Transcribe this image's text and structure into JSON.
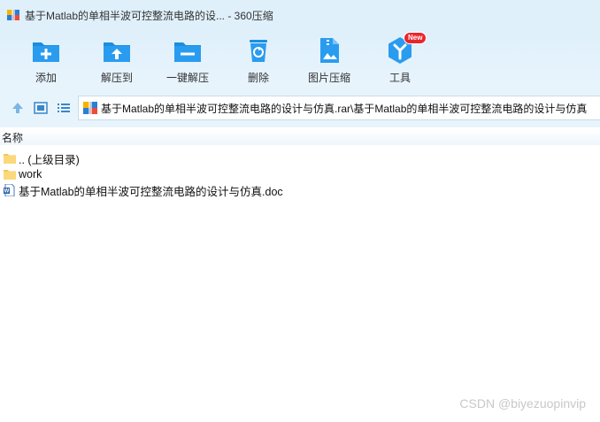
{
  "window": {
    "title": "基于Matlab的单相半波可控整流电路的设... - 360压缩"
  },
  "toolbar": {
    "items": [
      {
        "label": "添加",
        "icon": "add-icon"
      },
      {
        "label": "解压到",
        "icon": "extract-to-icon"
      },
      {
        "label": "一键解压",
        "icon": "one-click-extract-icon"
      },
      {
        "label": "删除",
        "icon": "delete-icon"
      },
      {
        "label": "图片压缩",
        "icon": "image-compress-icon"
      },
      {
        "label": "工具",
        "icon": "tools-icon",
        "badge": "New"
      }
    ]
  },
  "address": {
    "path": "基于Matlab的单相半波可控整流电路的设计与仿真.rar\\基于Matlab的单相半波可控整流电路的设计与仿真"
  },
  "list": {
    "column_name": "名称",
    "items": [
      {
        "name": ".. (上级目录)",
        "type": "folder"
      },
      {
        "name": "work",
        "type": "folder"
      },
      {
        "name": "基于Matlab的单相半波可控整流电路的设计与仿真.doc",
        "type": "doc"
      }
    ]
  },
  "watermark": "CSDN @biyezuopinvip",
  "colors": {
    "accent": "#1a8fe0",
    "titlebar_bg": "#dff0fb",
    "badge": "#e8262d"
  }
}
